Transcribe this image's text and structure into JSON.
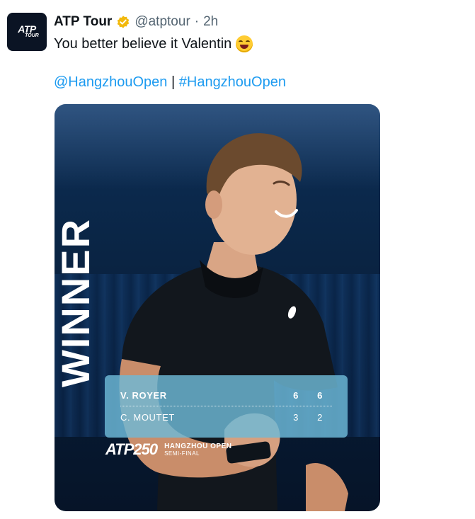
{
  "account": {
    "display_name": "ATP Tour",
    "handle": "@atptour",
    "separator": "·",
    "time": "2h",
    "avatar_text_main": "ATP",
    "avatar_text_sub": "TOUR"
  },
  "tweet": {
    "text": "You better believe it Valentin",
    "emoji": "grinning-face-icon",
    "mention": "@HangzhouOpen",
    "divider": "|",
    "hashtag": "#HangzhouOpen"
  },
  "media": {
    "winner_label": "WINNER",
    "scoreboard": {
      "players": [
        {
          "name": "V. ROYER",
          "sets": [
            "6",
            "6"
          ]
        },
        {
          "name": "C. MOUTET",
          "sets": [
            "3",
            "2"
          ]
        }
      ]
    },
    "brand_atp": "ATP250",
    "event_name": "HANGZHOU OPEN",
    "event_round": "SEMI-FINAL"
  },
  "colors": {
    "link": "#1d9bf0",
    "verified": "#f2b90c",
    "scoreboard": "#6eb9d7",
    "background_dark": "#0a2545"
  }
}
